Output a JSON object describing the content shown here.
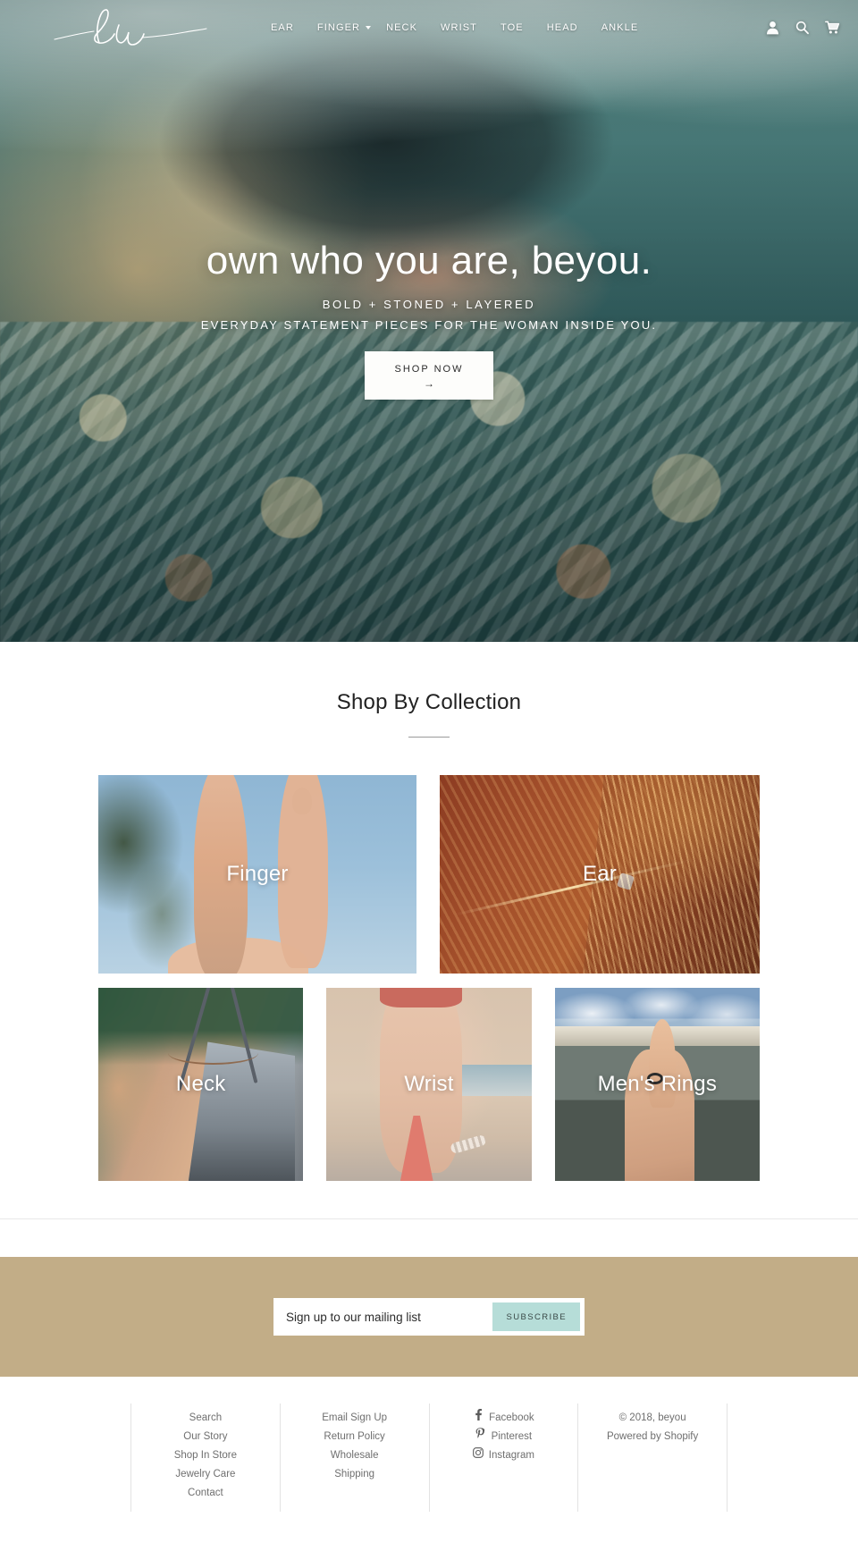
{
  "header": {
    "logo_text": "bu",
    "logo_name": "beyou-script-logo",
    "nav": [
      {
        "label": "EAR",
        "has_dropdown": false
      },
      {
        "label": "FINGER",
        "has_dropdown": true
      },
      {
        "label": "NECK",
        "has_dropdown": false
      },
      {
        "label": "WRIST",
        "has_dropdown": false
      },
      {
        "label": "TOE",
        "has_dropdown": false
      },
      {
        "label": "HEAD",
        "has_dropdown": false
      },
      {
        "label": "ANKLE",
        "has_dropdown": false
      }
    ],
    "icons": [
      {
        "name": "account-icon",
        "glyph": "person"
      },
      {
        "name": "search-icon",
        "glyph": "magnifier"
      },
      {
        "name": "cart-icon",
        "glyph": "shopping-cart"
      }
    ]
  },
  "hero": {
    "title": "own who you are, beyou.",
    "subtitle_1": "BOLD + STONED + LAYERED",
    "subtitle_2": "EVERYDAY STATEMENT PIECES FOR THE WOMAN INSIDE YOU.",
    "cta_label": "SHOP NOW",
    "cta_arrow": "→"
  },
  "collections": {
    "title": "Shop By Collection",
    "row1": [
      {
        "label": "Finger"
      },
      {
        "label": "Ear"
      }
    ],
    "row2": [
      {
        "label": "Neck"
      },
      {
        "label": "Wrist"
      },
      {
        "label": "Men's Rings"
      }
    ]
  },
  "newsletter": {
    "placeholder": "Sign up to our mailing list",
    "value": "",
    "button_label": "SUBSCRIBE",
    "background_color": "#c2ad87",
    "button_color": "#b6ddd8"
  },
  "footer": {
    "col1": [
      "Search",
      "Our Story",
      "Shop In Store",
      "Jewelry Care",
      "Contact"
    ],
    "col2": [
      "Email Sign Up",
      "Return Policy",
      "Wholesale",
      "Shipping"
    ],
    "social": [
      {
        "label": "Facebook",
        "icon": "facebook-icon",
        "glyph": "f"
      },
      {
        "label": "Pinterest",
        "icon": "pinterest-icon",
        "glyph": "P"
      },
      {
        "label": "Instagram",
        "icon": "instagram-icon",
        "glyph": "▣"
      }
    ],
    "copyright": "© 2018, beyou",
    "powered_by": "Powered by Shopify"
  }
}
